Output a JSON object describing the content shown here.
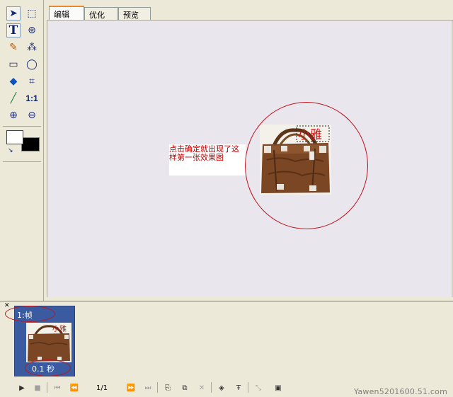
{
  "tools": [
    {
      "name": "pointer-tool",
      "icon": "arrow-pointer-icon",
      "glyph": "➤"
    },
    {
      "name": "marquee-select-tool",
      "icon": "marquee-select-icon",
      "glyph": "⬚"
    },
    {
      "name": "text-tool",
      "icon": "text-tool-icon",
      "glyph": "T"
    },
    {
      "name": "slice-select-tool",
      "icon": "slice-select-icon",
      "glyph": "⊛"
    },
    {
      "name": "paintbrush-tool",
      "icon": "paintbrush-icon",
      "glyph": "✎"
    },
    {
      "name": "magic-wand-tool",
      "icon": "magic-wand-icon",
      "glyph": "⁂"
    },
    {
      "name": "eraser-tool",
      "icon": "eraser-icon",
      "glyph": "▭"
    },
    {
      "name": "lasso-tool",
      "icon": "lasso-icon",
      "glyph": "◯"
    },
    {
      "name": "paint-bucket-tool",
      "icon": "paint-bucket-icon",
      "glyph": "◆"
    },
    {
      "name": "crop-tool",
      "icon": "crop-icon",
      "glyph": "⌗"
    },
    {
      "name": "eyedropper-tool",
      "icon": "eyedropper-icon",
      "glyph": "╱"
    },
    {
      "name": "actual-size-tool",
      "icon": "actual-size-icon",
      "glyph": "1:1"
    },
    {
      "name": "zoom-in-tool",
      "icon": "zoom-in-icon",
      "glyph": "⊕"
    },
    {
      "name": "zoom-out-tool",
      "icon": "zoom-out-icon",
      "glyph": "⊖"
    }
  ],
  "tabs": [
    {
      "label": "编辑",
      "active": true
    },
    {
      "label": "优化",
      "active": false
    },
    {
      "label": "预览",
      "active": false
    }
  ],
  "canvas": {
    "annotation": "点击确定就出现了这样第一张效果图",
    "overlay_text": "小雅"
  },
  "frames_panel": {
    "frame_label": "1:帧",
    "frame_delay": "0.1 秒",
    "thumb_overlay_text": "小雅"
  },
  "anim_controls": {
    "frame_counter": "1/1"
  },
  "watermark": "Yawen5201600.51.com",
  "colors": {
    "annotation_red": "#c00000",
    "circle_red": "#c0141c",
    "frame_tile_blue": "#3a5ba0",
    "active_tab_accent": "#e68b2c"
  }
}
